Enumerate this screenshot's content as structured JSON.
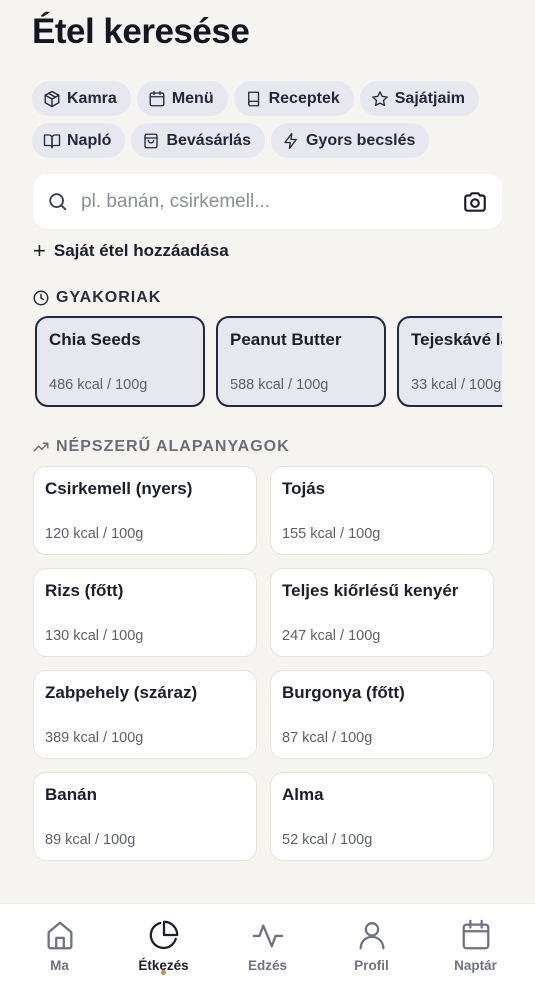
{
  "header": {
    "title": "Étel keresése"
  },
  "chips": {
    "row1": [
      {
        "label": "Kamra",
        "icon": "box-icon"
      },
      {
        "label": "Menü",
        "icon": "calendar-icon"
      },
      {
        "label": "Receptek",
        "icon": "book-icon"
      },
      {
        "label": "Sajátjaim",
        "icon": "star-icon"
      }
    ],
    "row2": [
      {
        "label": "Napló",
        "icon": "open-book-icon"
      },
      {
        "label": "Bevásárlás",
        "icon": "shopping-bag-icon"
      },
      {
        "label": "Gyors becslés",
        "icon": "lightning-icon"
      }
    ]
  },
  "search": {
    "placeholder": "pl. banán, csirkemell...",
    "value": ""
  },
  "add_own": {
    "label": "Saját étel hozzáadása"
  },
  "frequent": {
    "heading": "GYAKORIAK",
    "items": [
      {
        "name": "Chia Seeds",
        "kcal": "486 kcal / 100g"
      },
      {
        "name": "Peanut Butter",
        "kcal": "588 kcal / 100g"
      },
      {
        "name": "Tejeskávé laktózmentes",
        "kcal": "33 kcal / 100g"
      }
    ]
  },
  "popular": {
    "heading": "NÉPSZERŰ ALAPANYAGOK",
    "items": [
      {
        "name": "Csirkemell (nyers)",
        "kcal": "120 kcal / 100g"
      },
      {
        "name": "Tojás",
        "kcal": "155 kcal / 100g"
      },
      {
        "name": "Rizs (főtt)",
        "kcal": "130 kcal / 100g"
      },
      {
        "name": "Teljes kiőrlésű kenyér",
        "kcal": "247 kcal / 100g"
      },
      {
        "name": "Zabpehely (száraz)",
        "kcal": "389 kcal / 100g"
      },
      {
        "name": "Burgonya (főtt)",
        "kcal": "87 kcal / 100g"
      },
      {
        "name": "Banán",
        "kcal": "89 kcal / 100g"
      },
      {
        "name": "Alma",
        "kcal": "52 kcal / 100g"
      }
    ]
  },
  "tabbar": {
    "active": "Étkezés",
    "tabs": [
      {
        "label": "Ma",
        "icon": "home-icon"
      },
      {
        "label": "Étkezés",
        "icon": "pie-chart-icon"
      },
      {
        "label": "Edzés",
        "icon": "activity-icon"
      },
      {
        "label": "Profil",
        "icon": "user-icon"
      },
      {
        "label": "Naptár",
        "icon": "calendar-icon"
      }
    ]
  },
  "colors": {
    "background": "#f5f4f1",
    "chip_bg": "#e6e7ef",
    "card_bg": "#ffffff",
    "frequent_border": "#232840",
    "active_dot": "#c98a4b"
  }
}
